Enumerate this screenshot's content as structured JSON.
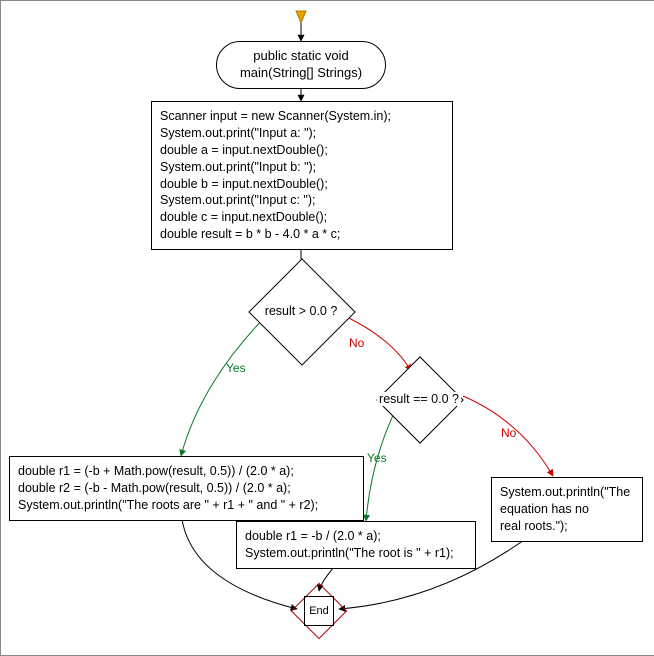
{
  "start": {
    "label": "public static void\nmain(String[] Strings)"
  },
  "init": {
    "code": "Scanner input = new Scanner(System.in);\nSystem.out.print(\"Input a: \");\ndouble a = input.nextDouble();\nSystem.out.print(\"Input b: \");\ndouble b = input.nextDouble();\nSystem.out.print(\"Input c: \");\ndouble c = input.nextDouble();\ndouble result = b * b - 4.0 * a * c;"
  },
  "decision1": {
    "label": "result > 0.0 ?",
    "yes": "Yes",
    "no": "No"
  },
  "decision2": {
    "label": "result == 0.0 ?",
    "yes": "Yes",
    "no": "No"
  },
  "tworoots": {
    "code": "double r1 = (-b + Math.pow(result, 0.5)) / (2.0 * a);\ndouble r2 = (-b - Math.pow(result, 0.5)) / (2.0 * a);\nSystem.out.println(\"The roots are \" + r1 + \" and \" + r2);"
  },
  "oneroot": {
    "code": "double r1 = -b / (2.0 * a);\nSystem.out.println(\"The root is \" + r1);"
  },
  "noroots": {
    "code": "System.out.println(\"The\nequation has no\nreal roots.\");"
  },
  "end": {
    "label": "End"
  }
}
